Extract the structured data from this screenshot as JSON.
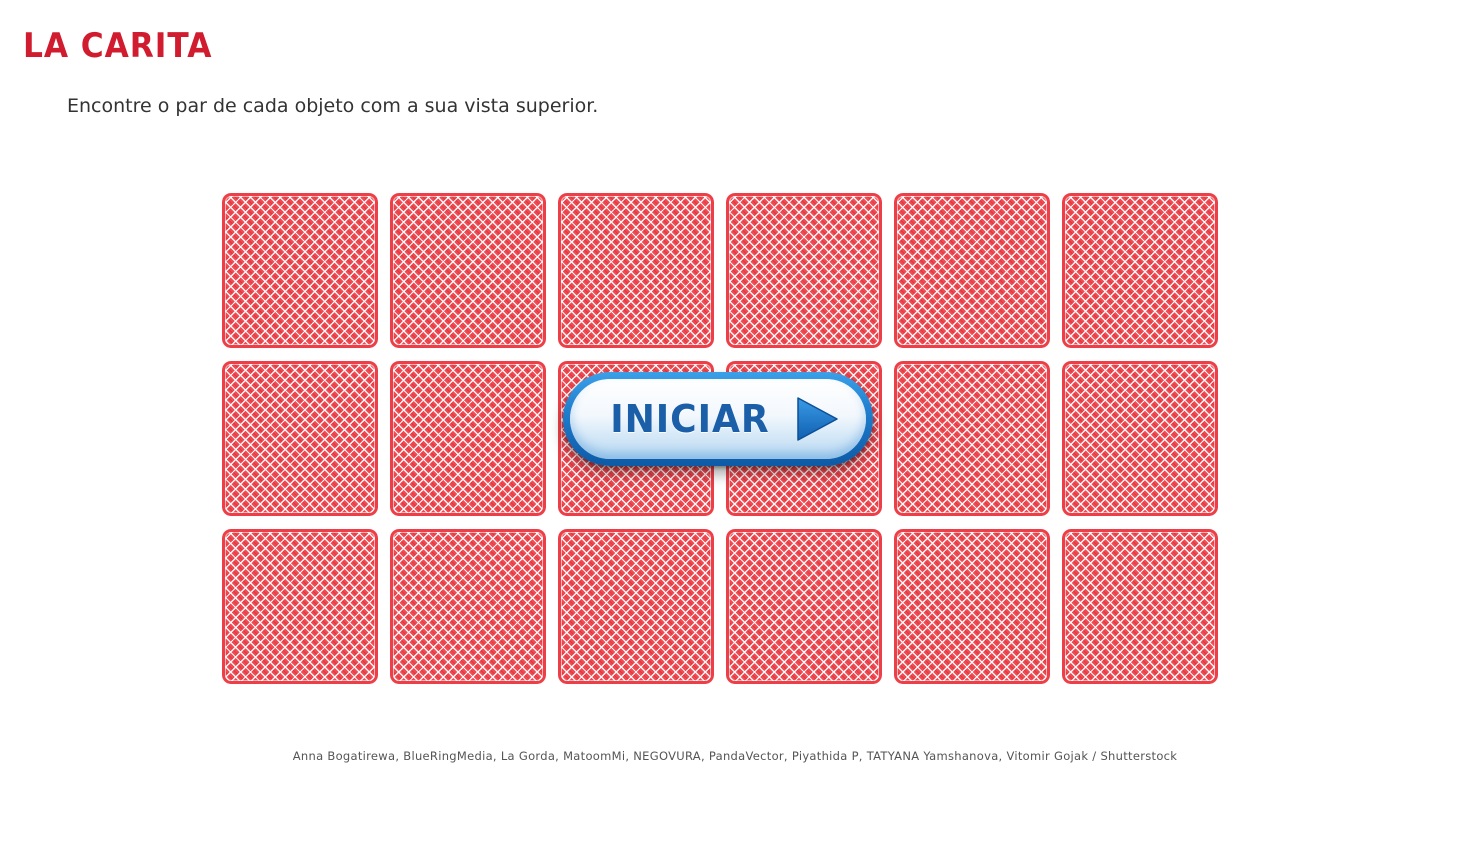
{
  "game": {
    "title": "LA CARITA",
    "instructions": "Encontre o par de cada objeto com a sua vista superior.",
    "start_button_label": "INICIAR",
    "start_button_icon": "play-triangle-icon",
    "credits": "Anna Bogatirewa, BlueRingMedia, La Gorda, MatoomMi, NEGOVURA, PandaVector, Piyathida P, TATYANA Yamshanova, Vitomir Gojak / Shutterstock"
  },
  "board": {
    "rows": 3,
    "columns": 6,
    "card_state": "face-down",
    "card_back_color": "#f04a52"
  },
  "colors": {
    "title": "#d01c2e",
    "button_blue": "#1a5fa8",
    "button_border": "#1c78c8"
  }
}
